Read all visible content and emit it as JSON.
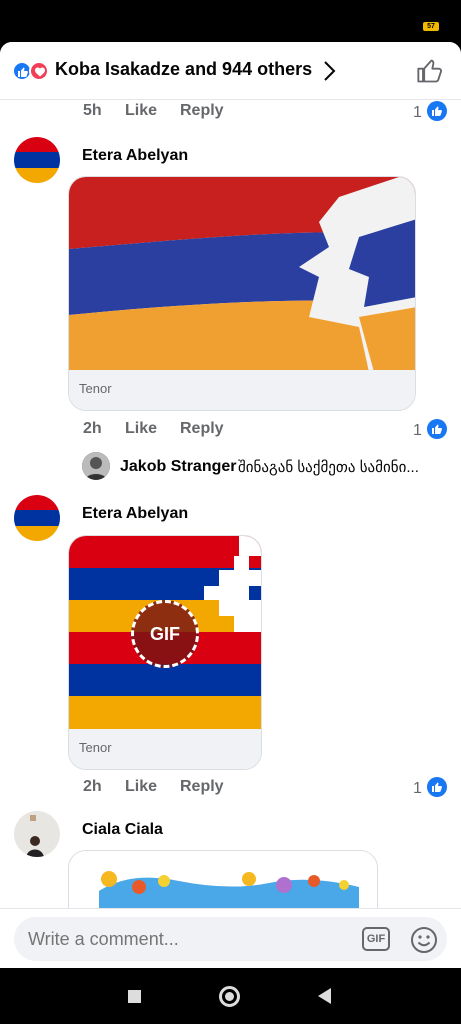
{
  "status_bar": {
    "battery": "57"
  },
  "header": {
    "title": "Koba Isakadze and 944 others"
  },
  "comments": [
    {
      "time": "5h",
      "like": "Like",
      "reply": "Reply",
      "likes": "1"
    },
    {
      "author": "Etera Abelyan",
      "gif_source": "Tenor",
      "time": "2h",
      "like": "Like",
      "reply": "Reply",
      "likes": "1",
      "reply_preview": {
        "author": "Jakob Stranger",
        "text": "შინაგან საქმეთა სამინი..."
      }
    },
    {
      "author": "Etera Abelyan",
      "gif_badge": "GIF",
      "gif_source": "Tenor",
      "time": "2h",
      "like": "Like",
      "reply": "Reply",
      "likes": "1"
    },
    {
      "author": "Ciala Ciala"
    }
  ],
  "composer": {
    "placeholder": "Write a comment...",
    "gif_label": "GIF"
  },
  "colors": {
    "accent": "#1877f2",
    "flag_red": "#d90012",
    "flag_blue": "#0033a0",
    "flag_orange": "#f2a800"
  }
}
